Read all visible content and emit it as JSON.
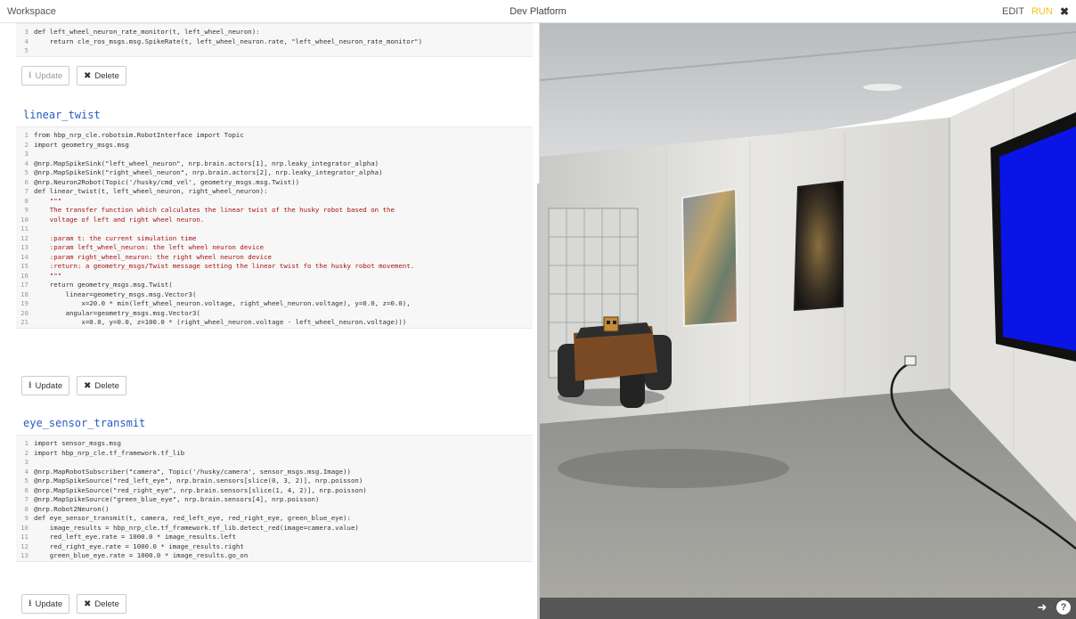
{
  "topbar": {
    "workspace_label": "Workspace",
    "title": "Dev Platform",
    "edit_label": "EDIT",
    "run_label": "RUN",
    "close_icon": "close-icon"
  },
  "editor": {
    "block0": {
      "lines": [
        {
          "n": "3",
          "t": "def left_wheel_neuron_rate_monitor(t, left_wheel_neuron):"
        },
        {
          "n": "4",
          "t": "    return cle_ros_msgs.msg.SpikeRate(t, left_wheel_neuron.rate, \"left_wheel_neuron_rate_monitor\")"
        },
        {
          "n": "5",
          "t": ""
        }
      ],
      "update_label": "Update",
      "delete_label": "Delete"
    },
    "block1": {
      "name": "linear_twist",
      "lines": [
        {
          "n": "1",
          "t": "from hbp_nrp_cle.robotsim.RobotInterface import Topic"
        },
        {
          "n": "2",
          "t": "import geometry_msgs.msg"
        },
        {
          "n": "3",
          "t": ""
        },
        {
          "n": "4",
          "t": "@nrp.MapSpikeSink(\"left_wheel_neuron\", nrp.brain.actors[1], nrp.leaky_integrator_alpha)"
        },
        {
          "n": "5",
          "t": "@nrp.MapSpikeSink(\"right_wheel_neuron\", nrp.brain.actors[2], nrp.leaky_integrator_alpha)"
        },
        {
          "n": "6",
          "t": "@nrp.Neuron2Robot(Topic('/husky/cmd_vel', geometry_msgs.msg.Twist))"
        },
        {
          "n": "7",
          "t": "def linear_twist(t, left_wheel_neuron, right_wheel_neuron):"
        },
        {
          "n": "8",
          "t": "    \"\"\""
        },
        {
          "n": "9",
          "t": "    The transfer function which calculates the linear twist of the husky robot based on the"
        },
        {
          "n": "10",
          "t": "    voltage of left and right wheel neuron."
        },
        {
          "n": "11",
          "t": ""
        },
        {
          "n": "12",
          "t": "    :param t: the current simulation time"
        },
        {
          "n": "13",
          "t": "    :param left_wheel_neuron: the left wheel neuron device"
        },
        {
          "n": "14",
          "t": "    :param right_wheel_neuron: the right wheel neuron device"
        },
        {
          "n": "15",
          "t": "    :return: a geometry_msgs/Twist message setting the linear twist fo the husky robot movement."
        },
        {
          "n": "16",
          "t": "    \"\"\""
        },
        {
          "n": "17",
          "t": "    return geometry_msgs.msg.Twist("
        },
        {
          "n": "18",
          "t": "        linear=geometry_msgs.msg.Vector3("
        },
        {
          "n": "19",
          "t": "            x=20.0 * min(left_wheel_neuron.voltage, right_wheel_neuron.voltage), y=0.0, z=0.0),"
        },
        {
          "n": "20",
          "t": "        angular=geometry_msgs.msg.Vector3("
        },
        {
          "n": "21",
          "t": "            x=0.0, y=0.0, z=100.0 * (right_wheel_neuron.voltage - left_wheel_neuron.voltage)))"
        }
      ],
      "update_label": "Update",
      "delete_label": "Delete"
    },
    "block2": {
      "name": "eye_sensor_transmit",
      "lines": [
        {
          "n": "1",
          "t": "import sensor_msgs.msg"
        },
        {
          "n": "2",
          "t": "import hbp_nrp_cle.tf_framework.tf_lib"
        },
        {
          "n": "3",
          "t": ""
        },
        {
          "n": "4",
          "t": "@nrp.MapRobotSubscriber(\"camera\", Topic('/husky/camera', sensor_msgs.msg.Image))"
        },
        {
          "n": "5",
          "t": "@nrp.MapSpikeSource(\"red_left_eye\", nrp.brain.sensors[slice(0, 3, 2)], nrp.poisson)"
        },
        {
          "n": "6",
          "t": "@nrp.MapSpikeSource(\"red_right_eye\", nrp.brain.sensors[slice(1, 4, 2)], nrp.poisson)"
        },
        {
          "n": "7",
          "t": "@nrp.MapSpikeSource(\"green_blue_eye\", nrp.brain.sensors[4], nrp.poisson)"
        },
        {
          "n": "8",
          "t": "@nrp.Robot2Neuron()"
        },
        {
          "n": "9",
          "t": "def eye_sensor_transmit(t, camera, red_left_eye, red_right_eye, green_blue_eye):"
        },
        {
          "n": "10",
          "t": "    image_results = hbp_nrp_cle.tf_framework.tf_lib.detect_red(image=camera.value)"
        },
        {
          "n": "11",
          "t": "    red_left_eye.rate = 1000.0 * image_results.left"
        },
        {
          "n": "12",
          "t": "    red_right_eye.rate = 1000.0 * image_results.right"
        },
        {
          "n": "13",
          "t": "    green_blue_eye.rate = 1000.0 * image_results.go_on"
        }
      ],
      "update_label": "Update",
      "delete_label": "Delete"
    }
  },
  "bottombar": {
    "exit_icon": "exit-icon",
    "help_icon": "help-icon"
  },
  "colors": {
    "accent_run": "#f0c419",
    "title_blue": "#2b59c3",
    "screen_blue": "#0a14e6"
  }
}
